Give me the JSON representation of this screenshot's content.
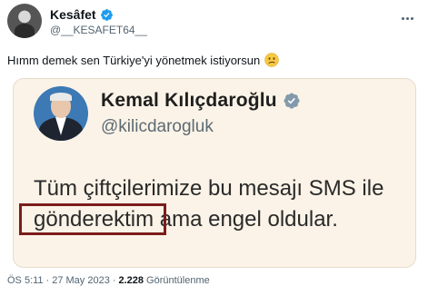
{
  "author": {
    "display_name": "Kesâfet",
    "handle": "@__KESAFET64__",
    "verified": true
  },
  "tweet": {
    "text": "Hımm demek sen Türkiye'yi yönetmek istiyorsun",
    "emoji": "confused-face-emoji"
  },
  "embedded_image": {
    "name": "Kemal Kılıçdaroğlu",
    "handle": "@kilicdarogluk",
    "verified": true,
    "text_line1": "Tüm çiftçilerimize bu mesajı SMS ile",
    "text_highlighted": "gönderektim",
    "text_rest": " ama engel oldular.",
    "highlight_color": "#7b1c1c",
    "background": "#fbf3e7"
  },
  "meta": {
    "time": "ÖS 5:11",
    "separator": "·",
    "date": "27 May 2023",
    "views_count": "2.228",
    "views_label": "Görüntülenme"
  },
  "colors": {
    "verified_blue": "#1d9bf0",
    "secondary_text": "#536471",
    "primary_text": "#0f1419"
  }
}
